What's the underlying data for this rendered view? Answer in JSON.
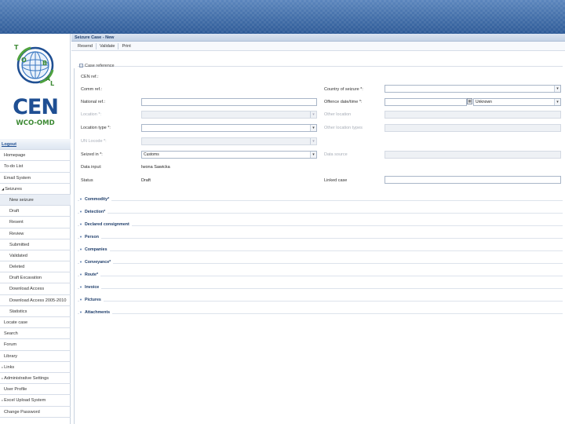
{
  "logo": {
    "text": "CEN",
    "subtext": "WCO-OMD",
    "letters": [
      "T",
      "O",
      "B",
      "A",
      "L"
    ]
  },
  "sidebar": {
    "items": [
      {
        "label": "Logout",
        "kind": "header"
      },
      {
        "label": "Homepage",
        "kind": "item"
      },
      {
        "label": "To-do List",
        "kind": "item"
      },
      {
        "label": "Email System",
        "kind": "item"
      },
      {
        "label": "Seizures",
        "kind": "section",
        "expander": "◢"
      },
      {
        "label": "New seizure",
        "kind": "sub",
        "selected": true
      },
      {
        "label": "Draft",
        "kind": "sub"
      },
      {
        "label": "Resent",
        "kind": "sub"
      },
      {
        "label": "Review",
        "kind": "sub"
      },
      {
        "label": "Submitted",
        "kind": "sub"
      },
      {
        "label": "Validated",
        "kind": "sub"
      },
      {
        "label": "Deleted",
        "kind": "sub"
      },
      {
        "label": "Draft Excavation",
        "kind": "sub"
      },
      {
        "label": "Download Access",
        "kind": "sub"
      },
      {
        "label": "Download Access 2005-2010",
        "kind": "sub"
      },
      {
        "label": "Statistics",
        "kind": "sub"
      },
      {
        "label": "Locate case",
        "kind": "item"
      },
      {
        "label": "Search",
        "kind": "item"
      },
      {
        "label": "Forum",
        "kind": "item"
      },
      {
        "label": "Library",
        "kind": "item"
      },
      {
        "label": "Links",
        "kind": "section",
        "expander": "▹"
      },
      {
        "label": "Administrative Settings",
        "kind": "section",
        "expander": "▹"
      },
      {
        "label": "User Profile",
        "kind": "item"
      },
      {
        "label": "Excel Upload System",
        "kind": "section",
        "expander": "▹"
      },
      {
        "label": "Change Password",
        "kind": "item"
      }
    ]
  },
  "main": {
    "title": "Seizure Case - New",
    "toolbar": [
      "Resend",
      "Validate",
      "Print"
    ],
    "case_reference": "Case reference",
    "cen_ref": "CEN ref.:",
    "fields": {
      "comm_ref": "Comm ref.:",
      "national_ref": "National ref.:",
      "location": "Location *:",
      "location_type": "Location type *:",
      "un_locode": "UN Locode *:",
      "seized_in": "Seized in *:",
      "seized_in_value": "Customs",
      "data_input": "Data input:",
      "data_input_value": "Iwona Sawicka",
      "status": "Status",
      "status_value": "Draft",
      "country_of_seizure": "Country of seizure *:",
      "offence_date_time": "Offence date/time *:",
      "offence_time_value": "Unknown",
      "other_location": "Other location",
      "other_location_types": "Other location types",
      "data_source": "Data source",
      "linked_case": "Linked case"
    },
    "sections": [
      "Commodity*",
      "Detection*",
      "Declared consignment",
      "Person",
      "Companies",
      "Conveyance*",
      "Route*",
      "Invoice",
      "Pictures",
      "Attachments"
    ]
  },
  "colors": {
    "banner": "#3d6aa6",
    "logo_blue": "#1f4f93",
    "logo_green": "#3d8a34",
    "link_blue": "#1f3e6b"
  }
}
